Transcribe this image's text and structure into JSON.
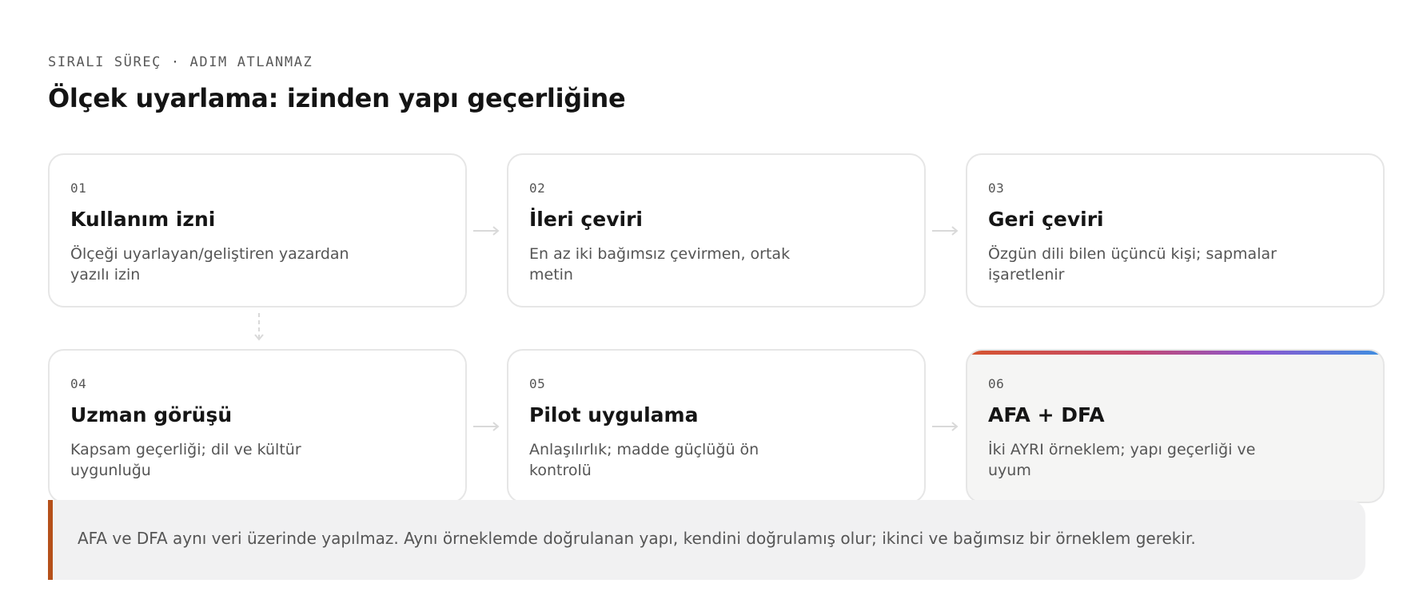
{
  "header": {
    "eyebrow": "SIRALI SÜREÇ · ADIM ATLANMAZ",
    "title": "Ölçek uyarlama: izinden yapı geçerliğine"
  },
  "steps": [
    {
      "num": "01",
      "title": "Kullanım izni",
      "desc": "Ölçeği uyarlayan/geliştiren yazardan yazılı izin"
    },
    {
      "num": "02",
      "title": "İleri çeviri",
      "desc": "En az iki bağımsız çevirmen, ortak metin"
    },
    {
      "num": "03",
      "title": "Geri çeviri",
      "desc": "Özgün dili bilen üçüncü kişi; sapmalar işaretlenir"
    },
    {
      "num": "04",
      "title": "Uzman görüşü",
      "desc": "Kapsam geçerliği; dil ve kültür uygunluğu"
    },
    {
      "num": "05",
      "title": "Pilot uygulama",
      "desc": "Anlaşılırlık; madde güçlüğü ön kontrolü"
    },
    {
      "num": "06",
      "title": "AFA + DFA",
      "desc": "İki AYRI örneklem; yapı geçerliği ve uyum"
    }
  ],
  "callout": {
    "text": "AFA ve DFA aynı veri üzerinde yapılmaz. Aynı örneklemde doğrulanan yapı, kendini doğrulamış olur; ikinci ve bağımsız bir örneklem gerekir."
  },
  "colors": {
    "callout_accent": "#b5501a",
    "card_border": "#e6e6e6",
    "arrow": "#d9d9d9"
  }
}
